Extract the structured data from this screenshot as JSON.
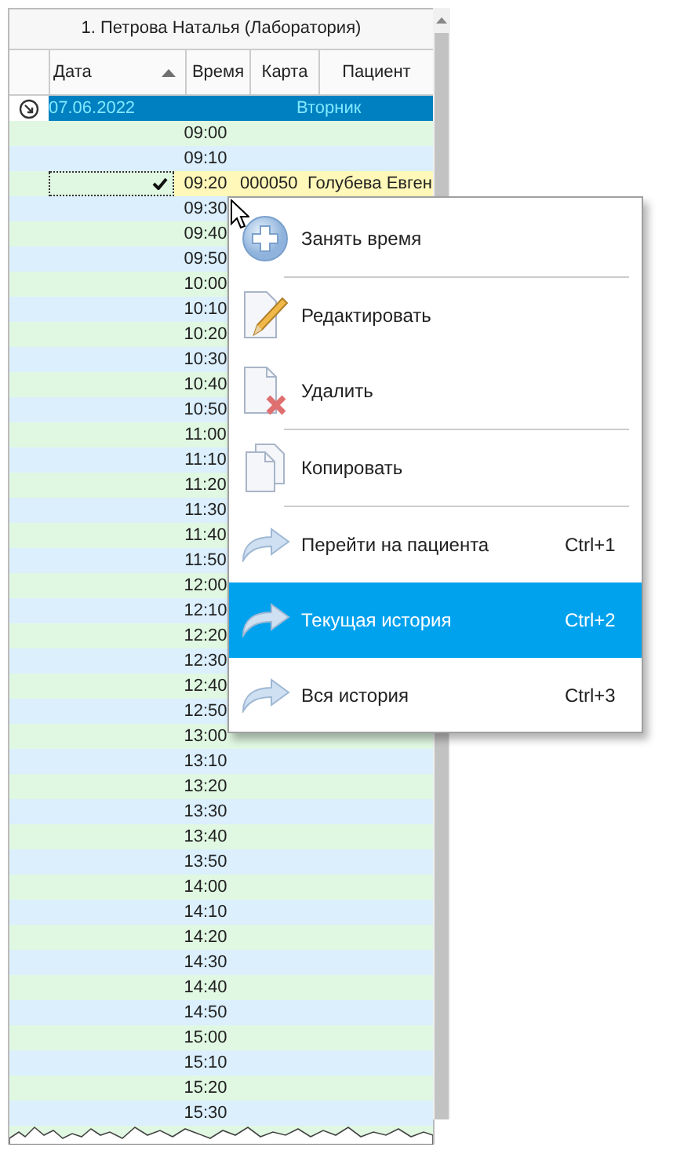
{
  "grid": {
    "title": "1. Петрова Наталья (Лаборатория)",
    "columns": [
      {
        "label": "Дата",
        "sorted": true
      },
      {
        "label": "Время",
        "sorted": false
      },
      {
        "label": "Карта",
        "sorted": false
      },
      {
        "label": "Пациент",
        "sorted": false
      }
    ],
    "group": {
      "date": "07.06.2022",
      "weekday": "Вторник",
      "expanded": true
    },
    "rows": [
      {
        "time": "09:00",
        "checked": false,
        "selected": false
      },
      {
        "time": "09:10",
        "checked": false,
        "selected": false
      },
      {
        "time": "09:20",
        "checked": true,
        "selected": true,
        "card": "000050",
        "patient": "Голубева Евген"
      },
      {
        "time": "09:30",
        "checked": false,
        "selected": false
      },
      {
        "time": "09:40",
        "checked": false,
        "selected": false
      },
      {
        "time": "09:50",
        "checked": false,
        "selected": false
      },
      {
        "time": "10:00",
        "checked": false,
        "selected": false
      },
      {
        "time": "10:10",
        "checked": false,
        "selected": false
      },
      {
        "time": "10:20",
        "checked": false,
        "selected": false
      },
      {
        "time": "10:30",
        "checked": false,
        "selected": false
      },
      {
        "time": "10:40",
        "checked": false,
        "selected": false
      },
      {
        "time": "10:50",
        "checked": false,
        "selected": false
      },
      {
        "time": "11:00",
        "checked": false,
        "selected": false
      },
      {
        "time": "11:10",
        "checked": false,
        "selected": false
      },
      {
        "time": "11:20",
        "checked": false,
        "selected": false
      },
      {
        "time": "11:30",
        "checked": false,
        "selected": false
      },
      {
        "time": "11:40",
        "checked": false,
        "selected": false
      },
      {
        "time": "11:50",
        "checked": false,
        "selected": false
      },
      {
        "time": "12:00",
        "checked": false,
        "selected": false
      },
      {
        "time": "12:10",
        "checked": false,
        "selected": false
      },
      {
        "time": "12:20",
        "checked": false,
        "selected": false
      },
      {
        "time": "12:30",
        "checked": false,
        "selected": false
      },
      {
        "time": "12:40",
        "checked": false,
        "selected": false
      },
      {
        "time": "12:50",
        "checked": false,
        "selected": false
      },
      {
        "time": "13:00",
        "checked": false,
        "selected": false
      },
      {
        "time": "13:10",
        "checked": false,
        "selected": false
      },
      {
        "time": "13:20",
        "checked": false,
        "selected": false
      },
      {
        "time": "13:30",
        "checked": false,
        "selected": false
      },
      {
        "time": "13:40",
        "checked": false,
        "selected": false
      },
      {
        "time": "13:50",
        "checked": false,
        "selected": false
      },
      {
        "time": "14:00",
        "checked": false,
        "selected": false
      },
      {
        "time": "14:10",
        "checked": false,
        "selected": false
      },
      {
        "time": "14:20",
        "checked": false,
        "selected": false
      },
      {
        "time": "14:30",
        "checked": false,
        "selected": false
      },
      {
        "time": "14:40",
        "checked": false,
        "selected": false
      },
      {
        "time": "14:50",
        "checked": false,
        "selected": false
      },
      {
        "time": "15:00",
        "checked": false,
        "selected": false
      },
      {
        "time": "15:10",
        "checked": false,
        "selected": false
      },
      {
        "time": "15:20",
        "checked": false,
        "selected": false
      },
      {
        "time": "15:30",
        "checked": false,
        "selected": false
      }
    ]
  },
  "context_menu": {
    "items": [
      {
        "kind": "add",
        "label": "Занять время",
        "selected": false
      },
      {
        "kind": "separator"
      },
      {
        "kind": "edit",
        "label": "Редактировать",
        "selected": false
      },
      {
        "kind": "delete",
        "label": "Удалить",
        "selected": false
      },
      {
        "kind": "separator"
      },
      {
        "kind": "copy",
        "label": "Копировать",
        "selected": false
      },
      {
        "kind": "separator"
      },
      {
        "kind": "navigate",
        "label": "Перейти на пациента",
        "shortcut": "Ctrl+1",
        "selected": false
      },
      {
        "kind": "navigate",
        "label": "Текущая история",
        "shortcut": "Ctrl+2",
        "selected": true
      },
      {
        "kind": "navigate",
        "label": "Вся история",
        "shortcut": "Ctrl+3",
        "selected": false
      }
    ]
  }
}
